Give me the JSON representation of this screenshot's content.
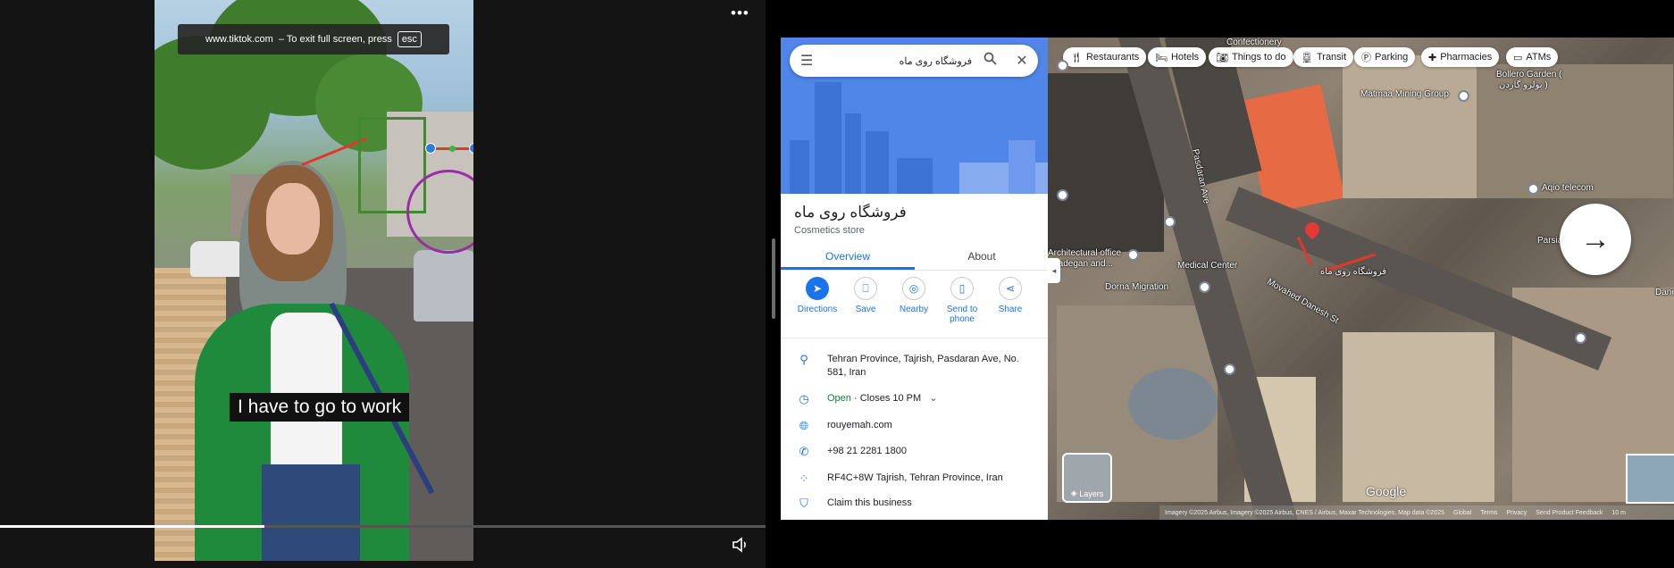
{
  "tiktok": {
    "fullscreen_url": "www.tiktok.com",
    "fullscreen_message": "– To exit full screen, press",
    "esc_key": "esc",
    "caption": "I have to go to work",
    "more_label": "•••",
    "progress_fraction": 0.345
  },
  "maps": {
    "search": {
      "value": "فروشگاه روی ماه"
    },
    "place": {
      "name": "فروشگاه روی ماه",
      "type": "Cosmetics store"
    },
    "tabs": [
      "Overview",
      "About"
    ],
    "actions": [
      {
        "label": "Directions",
        "icon": "directions-icon"
      },
      {
        "label": "Save",
        "icon": "bookmark-icon"
      },
      {
        "label": "Nearby",
        "icon": "nearby-icon"
      },
      {
        "label": "Send to phone",
        "icon": "phone-send-icon"
      },
      {
        "label": "Share",
        "icon": "share-icon"
      }
    ],
    "info": {
      "address": "Tehran Province, Tajrish, Pasdaran Ave, No. 581, Iran",
      "open_status": "Open",
      "closes": "· Closes 10 PM",
      "website": "rouyemah.com",
      "phone": "+98 21 2281 1800",
      "plus_code": "RF4C+8W Tajrish, Tehran Province, Iran",
      "claim": "Claim this business"
    },
    "chips": [
      "Restaurants",
      "Hotels",
      "Things to do",
      "Transit",
      "Parking",
      "Pharmacies",
      "ATMs"
    ],
    "labels": {
      "confectionery": "Confectionery",
      "bollero": "Bollero Garden (",
      "bollero_fa": "بولرو گاردن )",
      "matmaa": "Matmaa Mining Group",
      "pasdaran": "Pasdaran Ave",
      "aqio": "Aqio telecom",
      "parsian": "Parsian Bank",
      "architectural": "Architectural office",
      "architectural2": "Azadegan and...",
      "medical": "Medical Center",
      "dorna": "Dorna Migration",
      "movahed": "Movahed Danesh St",
      "store_fa": "فروشگاه روی ماه",
      "danesh": "Danesh"
    },
    "layers_label": "Layers",
    "google": "Google",
    "attribution": "Imagery ©2025 Airbus, Imagery ©2025 Airbus, CNES / Airbus, Maxar Technologies, Map data ©2025",
    "footer_links": [
      "Global",
      "Terms",
      "Privacy",
      "Send Product Feedback",
      "10 m"
    ],
    "next_arrow": "→"
  }
}
